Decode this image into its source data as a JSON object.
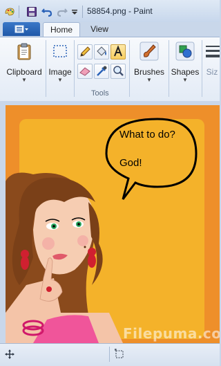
{
  "window": {
    "title": "58854.png - Paint"
  },
  "ribbon": {
    "tabs": [
      {
        "label": "Home",
        "active": true
      },
      {
        "label": "View",
        "active": false
      }
    ],
    "groups": {
      "clipboard": "Clipboard",
      "image": "Image",
      "tools": "Tools",
      "brushes": "Brushes",
      "shapes": "Shapes",
      "size": "Siz"
    }
  },
  "canvas": {
    "bubble_line1": "What to do?",
    "bubble_line2": "God!",
    "watermark": "Filepuma.com"
  },
  "colors": {
    "accent": "#1f58a8",
    "canvas_border": "#ee8f2a",
    "canvas_inner": "#f4b22a"
  }
}
